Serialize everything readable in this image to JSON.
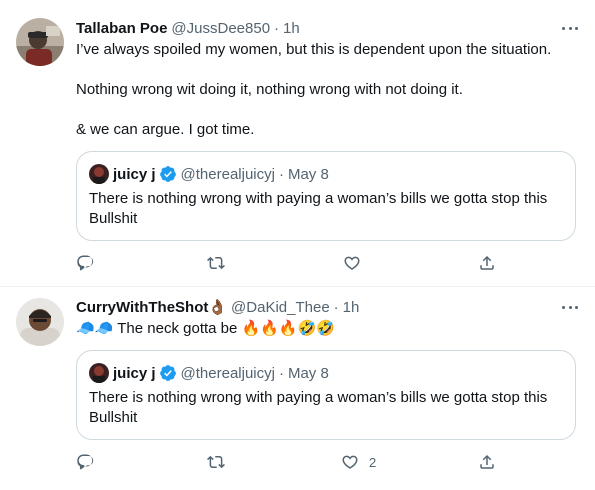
{
  "tweets": [
    {
      "display_name": "Tallaban Poe",
      "handle": "@JussDee850",
      "separator": "·",
      "time": "1h",
      "lines": [
        "I’ve always spoiled my women, but this is dependent upon the situation.",
        "Nothing wrong wit doing it, nothing wrong with not doing it.",
        "& we can argue. I got time."
      ],
      "quote": {
        "display_name": "juicy j",
        "handle": "@therealjuicyj",
        "separator": "·",
        "date": "May 8",
        "lines": [
          "There is nothing wrong with paying a woman’s bills we gotta stop this",
          "Bullshit"
        ]
      },
      "actions": {
        "reply_count": "",
        "retweet_count": "",
        "like_count": ""
      }
    },
    {
      "display_name": "CurryWithTheShot",
      "name_emoji": "👌🏾",
      "handle": "@DaKid_Thee",
      "separator": "·",
      "time": "1h",
      "text_prefix_emoji": "🧢🧢",
      "text": "The neck gotta be",
      "text_suffix_emoji": "🔥🔥🔥🤣🤣",
      "quote": {
        "display_name": "juicy j",
        "handle": "@therealjuicyj",
        "separator": "·",
        "date": "May 8",
        "lines": [
          "There is nothing wrong with paying a woman’s bills we gotta stop this",
          "Bullshit"
        ]
      },
      "actions": {
        "reply_count": "",
        "retweet_count": "",
        "like_count": "2"
      }
    }
  ],
  "icons": {
    "more": "more-horizontal-icon",
    "reply": "reply-icon",
    "retweet": "retweet-icon",
    "like": "heart-icon",
    "share": "share-icon",
    "verified": "verified-badge-icon"
  },
  "colors": {
    "text": "#0f1419",
    "secondary": "#536471",
    "border": "#cfd9de",
    "divider": "#eff3f4",
    "verified": "#1d9bf0"
  }
}
